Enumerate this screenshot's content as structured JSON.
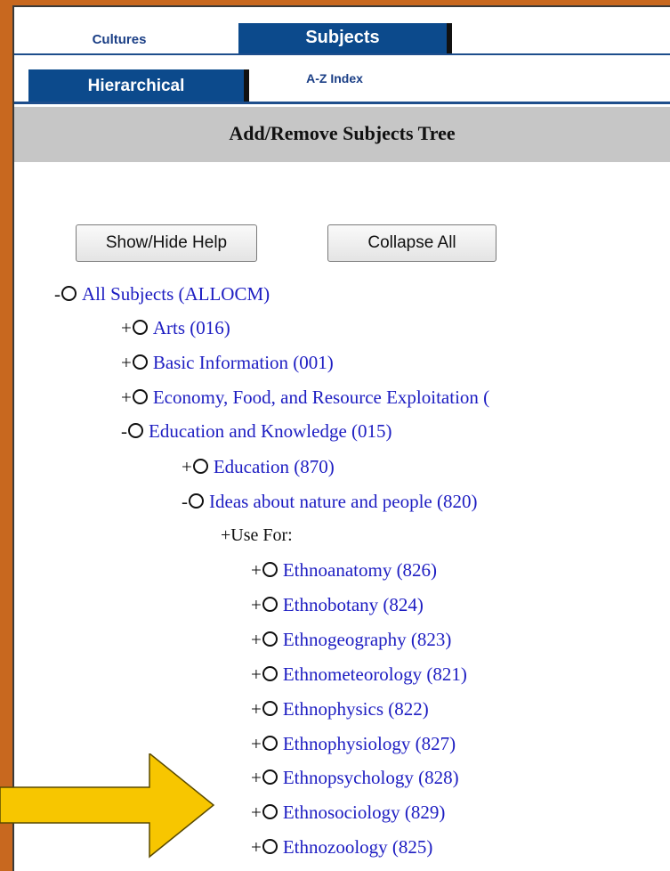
{
  "tabs_top": {
    "cultures": "Cultures",
    "subjects": "Subjects"
  },
  "tabs_sub": {
    "hierarchical": "Hierarchical",
    "az_index": "A-Z Index"
  },
  "header": {
    "title": "Add/Remove Subjects Tree"
  },
  "buttons": {
    "show_hide_help": "Show/Hide Help",
    "collapse_all": "Collapse All"
  },
  "tree": {
    "root": {
      "sign": "-",
      "label": "All Subjects (ALLOCM)"
    },
    "level1": [
      {
        "sign": "+",
        "label": "Arts (016)"
      },
      {
        "sign": "+",
        "label": "Basic Information (001)"
      },
      {
        "sign": "+",
        "label": "Economy, Food, and Resource Exploitation ("
      },
      {
        "sign": "-",
        "label": "Education and Knowledge (015)"
      }
    ],
    "level2": [
      {
        "sign": "+",
        "label": "Education (870)"
      },
      {
        "sign": "-",
        "label": "Ideas about nature and people (820)"
      }
    ],
    "use_for": "+Use For:",
    "level3": [
      {
        "sign": "+",
        "label": "Ethnoanatomy (826)"
      },
      {
        "sign": "+",
        "label": "Ethnobotany (824)"
      },
      {
        "sign": "+",
        "label": "Ethnogeography (823)"
      },
      {
        "sign": "+",
        "label": "Ethnometeorology (821)"
      },
      {
        "sign": "+",
        "label": "Ethnophysics (822)"
      },
      {
        "sign": "+",
        "label": "Ethnophysiology (827)"
      },
      {
        "sign": "+",
        "label": "Ethnopsychology (828)"
      },
      {
        "sign": "+",
        "label": "Ethnosociology (829)"
      },
      {
        "sign": "+",
        "label": "Ethnozoology (825)"
      }
    ]
  },
  "colors": {
    "frame": "#c8681f",
    "tab_active": "#0c4a8c",
    "link": "#1d1dc2",
    "arrow": "#f7c600"
  },
  "icons": {
    "tree_node": "radio-circle-icon",
    "pointer": "yellow-arrow-icon"
  }
}
